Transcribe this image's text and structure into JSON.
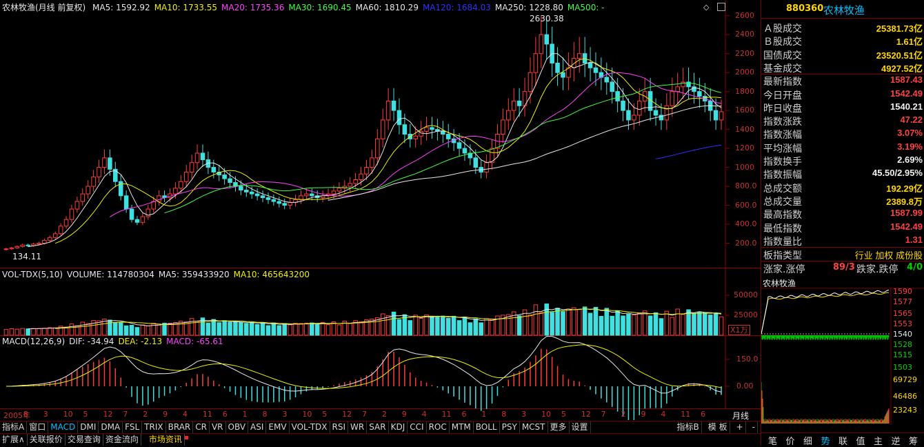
{
  "main_chart": {
    "title": "农林牧渔(月线 前复权)",
    "ma_legend": [
      {
        "label": "MA5: 1592.92",
        "color": "#e8e8e8"
      },
      {
        "label": "MA10: 1733.55",
        "color": "#f0f000"
      },
      {
        "label": "MA20: 1735.36",
        "color": "#ff40ff"
      },
      {
        "label": "MA30: 1690.45",
        "color": "#40ff40"
      },
      {
        "label": "MA60: 1810.29",
        "color": "#e8e8e8"
      },
      {
        "label": "MA120: 1684.03",
        "color": "#3030ff"
      },
      {
        "label": "MA250: 1228.80",
        "color": "#e8e8e8"
      },
      {
        "label": "MA500: -",
        "color": "#40ff40"
      }
    ],
    "high_marker": "2630.38",
    "low_marker": "134.11",
    "y_ticks": [
      "2600",
      "2400",
      "2200",
      "2000",
      "1800",
      "1600",
      "1400",
      "1200",
      "1000",
      "800.0",
      "600.0",
      "400.0",
      "200.0"
    ]
  },
  "volume_panel": {
    "legend": [
      {
        "label": "VOL-TDX(5,10)",
        "color": "#e8e8e8"
      },
      {
        "label": "VOLUME: 114780304",
        "color": "#e8e8e8"
      },
      {
        "label": "MA5: 359433920",
        "color": "#e8e8e8"
      },
      {
        "label": "MA10: 465643200",
        "color": "#f0f000"
      }
    ],
    "y_ticks": [
      "50000",
      "25000"
    ],
    "unit": "X1万"
  },
  "macd_panel": {
    "legend": [
      {
        "label": "MACD(12,26,9)",
        "color": "#e8e8e8"
      },
      {
        "label": "DIF: -34.94",
        "color": "#e8e8e8"
      },
      {
        "label": "DEA: -2.13",
        "color": "#f0f000"
      },
      {
        "label": "MACD: -65.61",
        "color": "#ff40ff"
      }
    ],
    "y_ticks": [
      "150.0",
      "0.00"
    ]
  },
  "time_axis": {
    "labels": [
      "2005年",
      "8",
      "3",
      "10",
      "5",
      "12",
      "7",
      "2",
      "9",
      "4",
      "11",
      "6",
      "1",
      "8",
      "3",
      "10",
      "5",
      "12",
      "7",
      "2",
      "9",
      "4",
      "11",
      "6",
      "1",
      "8",
      "3",
      "10",
      "5",
      "12",
      "7",
      "2",
      "9",
      "4",
      "11",
      "6"
    ],
    "period": "月线"
  },
  "indicator_tabs": [
    "指标A",
    "窗口",
    "MACD",
    "DMI",
    "DMA",
    "FSL",
    "TRIX",
    "BRAR",
    "CR",
    "VR",
    "OBV",
    "ASI",
    "EMV",
    "VOL-TDX",
    "RSI",
    "WR",
    "SAR",
    "KDJ",
    "CCI",
    "ROC",
    "MTM",
    "BOLL",
    "PSY",
    "MCST",
    "更多",
    "设置"
  ],
  "indicator_tabs_active": "MACD",
  "indicator_tabs_right": [
    "指标B",
    "模 板",
    "+",
    "-"
  ],
  "bottom_tabs": [
    "扩展∧",
    "关联报价",
    "交易查询",
    "资金流向"
  ],
  "bottom_tab_news": "市场资讯",
  "panel": {
    "code": "880360",
    "name": "农林牧渔",
    "rows": [
      {
        "k": "Ａ股成交",
        "v": "25381.73亿",
        "c": "yel"
      },
      {
        "k": "Ｂ股成交",
        "v": "1.61亿",
        "c": "yel"
      },
      {
        "k": "国债成交",
        "v": "23520.51亿",
        "c": "yel"
      },
      {
        "k": "基金成交",
        "v": "4927.52亿",
        "c": "yel"
      },
      {
        "k": "最新指数",
        "v": "1587.43",
        "c": "red"
      },
      {
        "k": "今日开盘",
        "v": "1542.49",
        "c": "red"
      },
      {
        "k": "昨日收盘",
        "v": "1540.21",
        "c": "wht"
      },
      {
        "k": "指数涨跌",
        "v": "47.22",
        "c": "red"
      },
      {
        "k": "指数涨幅",
        "v": "3.07%",
        "c": "red"
      },
      {
        "k": "平均涨幅",
        "v": "3.19%",
        "c": "red"
      },
      {
        "k": "指数换手",
        "v": "2.69%",
        "c": "wht"
      },
      {
        "k": "指数振幅",
        "v": "45.50/2.95%",
        "c": "wht"
      },
      {
        "k": "总成交额",
        "v": "192.29亿",
        "c": "yel"
      },
      {
        "k": "总成交量",
        "v": "2389.8万",
        "c": "yel"
      },
      {
        "k": "最高指数",
        "v": "1587.99",
        "c": "red"
      },
      {
        "k": "最低指数",
        "v": "1542.49",
        "c": "red"
      },
      {
        "k": "指数量比",
        "v": "1.31",
        "c": "red"
      }
    ],
    "sector_type_label": "板指类型",
    "sector_type_value": "行业 加权 成份股",
    "rise_limit_label": "涨家.涨停",
    "rise_limit_value": "89/3",
    "fall_limit_label": "跌家.跌停",
    "fall_limit_value": "4/0",
    "mini_title": "农林牧渔",
    "mini_price_ticks": [
      "1590",
      "1577",
      "1565",
      "1553",
      "1540",
      "1528",
      "1515",
      "1503"
    ],
    "mini_vol_ticks": [
      "69729",
      "46486",
      "23243"
    ],
    "tabs": [
      "笔",
      "价",
      "细",
      "势",
      "联",
      "值",
      "主",
      "逆",
      "筹"
    ],
    "tab_active": "势"
  },
  "chart_data": {
    "type": "candlestick",
    "title": "农林牧渔(月线 前复权)",
    "period": "monthly",
    "price_ylim": [
      134.11,
      2630.38
    ],
    "grid": false,
    "notes_values": {
      "ma": {
        "MA5": 1592.92,
        "MA10": 1733.55,
        "MA20": 1735.36,
        "MA30": 1690.45,
        "MA60": 1810.29,
        "MA120": 1684.03,
        "MA250": 1228.8
      },
      "volume": 114780304,
      "vol_ma5": 359433920,
      "vol_ma10": 465643200,
      "macd": {
        "DIF": -34.94,
        "DEA": -2.13,
        "MACD": -65.61
      }
    },
    "close_series": [
      140,
      150,
      165,
      180,
      175,
      190,
      200,
      230,
      260,
      300,
      380,
      450,
      560,
      640,
      720,
      800,
      900,
      1000,
      1100,
      980,
      850,
      700,
      560,
      450,
      420,
      480,
      560,
      640,
      700,
      680,
      720,
      780,
      850,
      950,
      1050,
      1150,
      1080,
      1000,
      950,
      920,
      880,
      840,
      800,
      760,
      740,
      720,
      700,
      680,
      660,
      640,
      620,
      600,
      630,
      660,
      700,
      720,
      700,
      680,
      700,
      720,
      750,
      780,
      800,
      830,
      870,
      930,
      1000,
      1100,
      1300,
      1500,
      1700,
      1600,
      1450,
      1350,
      1300,
      1330,
      1380,
      1420,
      1400,
      1380,
      1350,
      1300,
      1260,
      1200,
      1150,
      1100,
      1000,
      950,
      1050,
      1200,
      1350,
      1500,
      1600,
      1700,
      1650,
      1800,
      2000,
      2200,
      2400,
      2300,
      2100,
      2000,
      1950,
      2050,
      2150,
      2200,
      2100,
      2050,
      2000,
      1950,
      1900,
      1800,
      1700,
      1600,
      1500,
      1550,
      1700,
      1800,
      1600,
      1550,
      1500,
      1650,
      1800,
      1850,
      1900,
      1850,
      1800,
      1750,
      1700,
      1600,
      1500,
      1587
    ]
  }
}
